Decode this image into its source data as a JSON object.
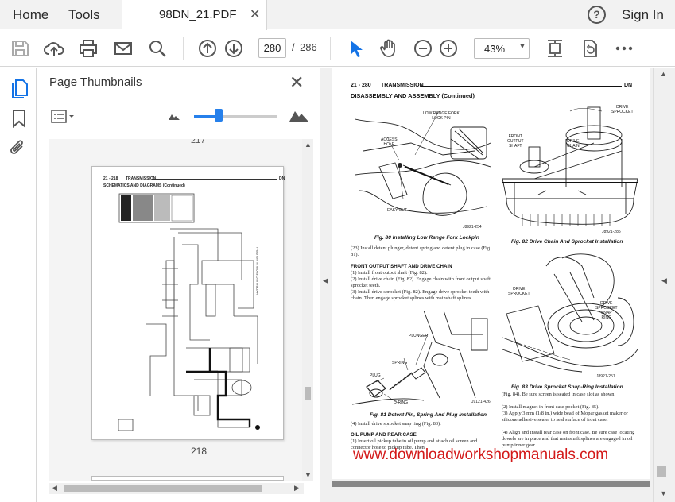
{
  "menu": {
    "home": "Home",
    "tools": "Tools",
    "sign_in": "Sign In",
    "help_glyph": "?"
  },
  "tab": {
    "title": "98DN_21.PDF",
    "close_glyph": "✕"
  },
  "toolbar": {
    "current_page": "280",
    "page_sep": "/",
    "total_pages": "286",
    "zoom": "43%",
    "icons": [
      "save-icon",
      "upload-cloud-icon",
      "print-icon",
      "mail-icon",
      "search-icon",
      "prev-page-icon",
      "next-page-icon",
      "select-cursor-icon",
      "hand-tool-icon",
      "zoom-out-icon",
      "zoom-in-icon",
      "fit-page-icon",
      "rotate-icon",
      "more-icon"
    ]
  },
  "left_rail": {
    "icons": [
      "page-thumbnails-icon",
      "bookmark-icon",
      "attachment-icon"
    ]
  },
  "thumbnails": {
    "title": "Page Thumbnails",
    "close_glyph": "✕",
    "prev_label": "217",
    "page_label": "218",
    "slider_value": 0.3,
    "thumb_page": {
      "header_left": "21 - 218",
      "header_mid": "TRANSMISSION",
      "header_right": "DN",
      "subtitle": "SCHEMATICS AND DIAGRAMS (Continued)",
      "side_caption": "HYDRAULIC FLOW IN NEUTRAL"
    }
  },
  "document": {
    "header_left": "21 - 280",
    "header_mid": "TRANSMISSION",
    "header_right": "DN",
    "section_title": "DISASSEMBLY AND ASSEMBLY (Continued)",
    "fig80": {
      "callouts": [
        "LOW RANGE FORK\nLOCK PIN",
        "ACCESS\nHOLE",
        "EASY-OUT"
      ],
      "id": "J8921-254",
      "caption": "Fig. 80 Installing Low Range Fork Lockpin"
    },
    "fig82": {
      "callouts": [
        "DRIVE\nSPROCKET",
        "FRONT\nOUTPUT\nSHAFT",
        "DRIVE\nCHAIN"
      ],
      "id": "J8921-285",
      "caption": "Fig. 82 Drive Chain And Sprocket Installation"
    },
    "para23": "(23) Install detent plunger, detent spring and detent plug in case (Fig. 81).",
    "heading_front": "FRONT OUTPUT SHAFT AND DRIVE CHAIN",
    "steps_front": [
      "(1) Install front output shaft (Fig. 82).",
      "(2) Install drive chain (Fig. 82). Engage chain with front output shaft sprocket teeth.",
      "(3) Install drive sprocket (Fig. 82). Engage drive sprocket teeth with chain. Then engage sprocket splines with mainshaft splines."
    ],
    "fig83": {
      "callouts": [
        "DRIVE\nSPROCKET",
        "DRIVE\nSPROCKET\nSNAP\nRING"
      ],
      "id": "J8921-251",
      "caption": "Fig. 83 Drive Sprocket Snap-Ring Installation"
    },
    "fig81": {
      "callouts": [
        "PLUNGER",
        "SPRING",
        "PLUG",
        "O-RING"
      ],
      "id": "J9121-426",
      "caption": "Fig. 81 Detent Pin, Spring And Plug Installation"
    },
    "step4": "(4) Install drive sprocket snap ring (Fig. 83).",
    "heading_oil": "OIL PUMP AND REAR CASE",
    "oil_step1": "(1) Insert oil pickup tube in oil pump and attach oil screen and connector hose to pickup tube. Then",
    "right_col": [
      "(Fig. 84). Be sure screen is seated in case slot as shown.",
      "(2) Install magnet in front case pocket (Fig. 85).",
      "(3) Apply 3 mm (1/8 in.) wide bead of Mopar gasket maker or silicone adhesive sealer to seal surface of front case.",
      "(4) Align and install rear case on front case. Be sure case locating dowels are in place and that mainshaft splines are engaged in oil pump inner gear."
    ],
    "watermark": "www.downloadworkshopmanuals.com"
  }
}
